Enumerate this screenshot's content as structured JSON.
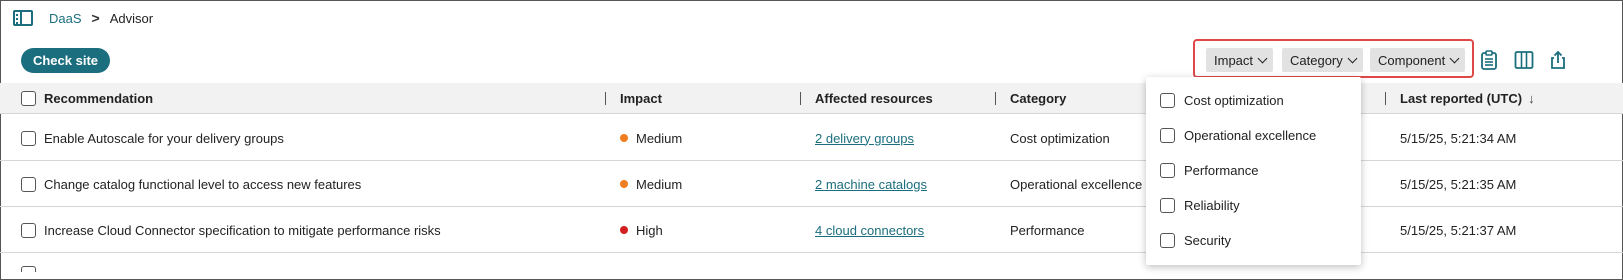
{
  "breadcrumb": {
    "root": "DaaS",
    "separator": ">",
    "current": "Advisor"
  },
  "toolbar": {
    "check_site_label": "Check site"
  },
  "filters": [
    {
      "label": "Impact"
    },
    {
      "label": "Category"
    },
    {
      "label": "Component"
    }
  ],
  "icons": {
    "toggle": "sidebar-toggle-icon",
    "clipboard": "clipboard-icon",
    "columns": "columns-icon",
    "export": "export-icon"
  },
  "colors": {
    "accent": "#1b6e7e",
    "highlight": "#e04848",
    "medium": "#f07d1f",
    "high": "#d21f1f"
  },
  "table": {
    "headers": {
      "recommendation": "Recommendation",
      "impact": "Impact",
      "affected": "Affected resources",
      "category": "Category",
      "last_reported": "Last reported (UTC)"
    },
    "sort_indicator": "↓",
    "rows": [
      {
        "recommendation": "Enable Autoscale for your delivery groups",
        "impact": "Medium",
        "affected": "2 delivery groups",
        "category": "Cost optimization",
        "last_reported": "5/15/25, 5:21:34 AM"
      },
      {
        "recommendation": "Change catalog functional level to access new features",
        "impact": "Medium",
        "affected": "2 machine catalogs",
        "category": "Operational excellence",
        "last_reported": "5/15/25, 5:21:35 AM"
      },
      {
        "recommendation": "Increase Cloud Connector specification to mitigate performance risks",
        "impact": "High",
        "affected": "4 cloud connectors",
        "category": "Performance",
        "last_reported": "5/15/25, 5:21:37 AM"
      }
    ]
  },
  "category_dropdown": {
    "options": [
      "Cost optimization",
      "Operational excellence",
      "Performance",
      "Reliability",
      "Security"
    ]
  }
}
